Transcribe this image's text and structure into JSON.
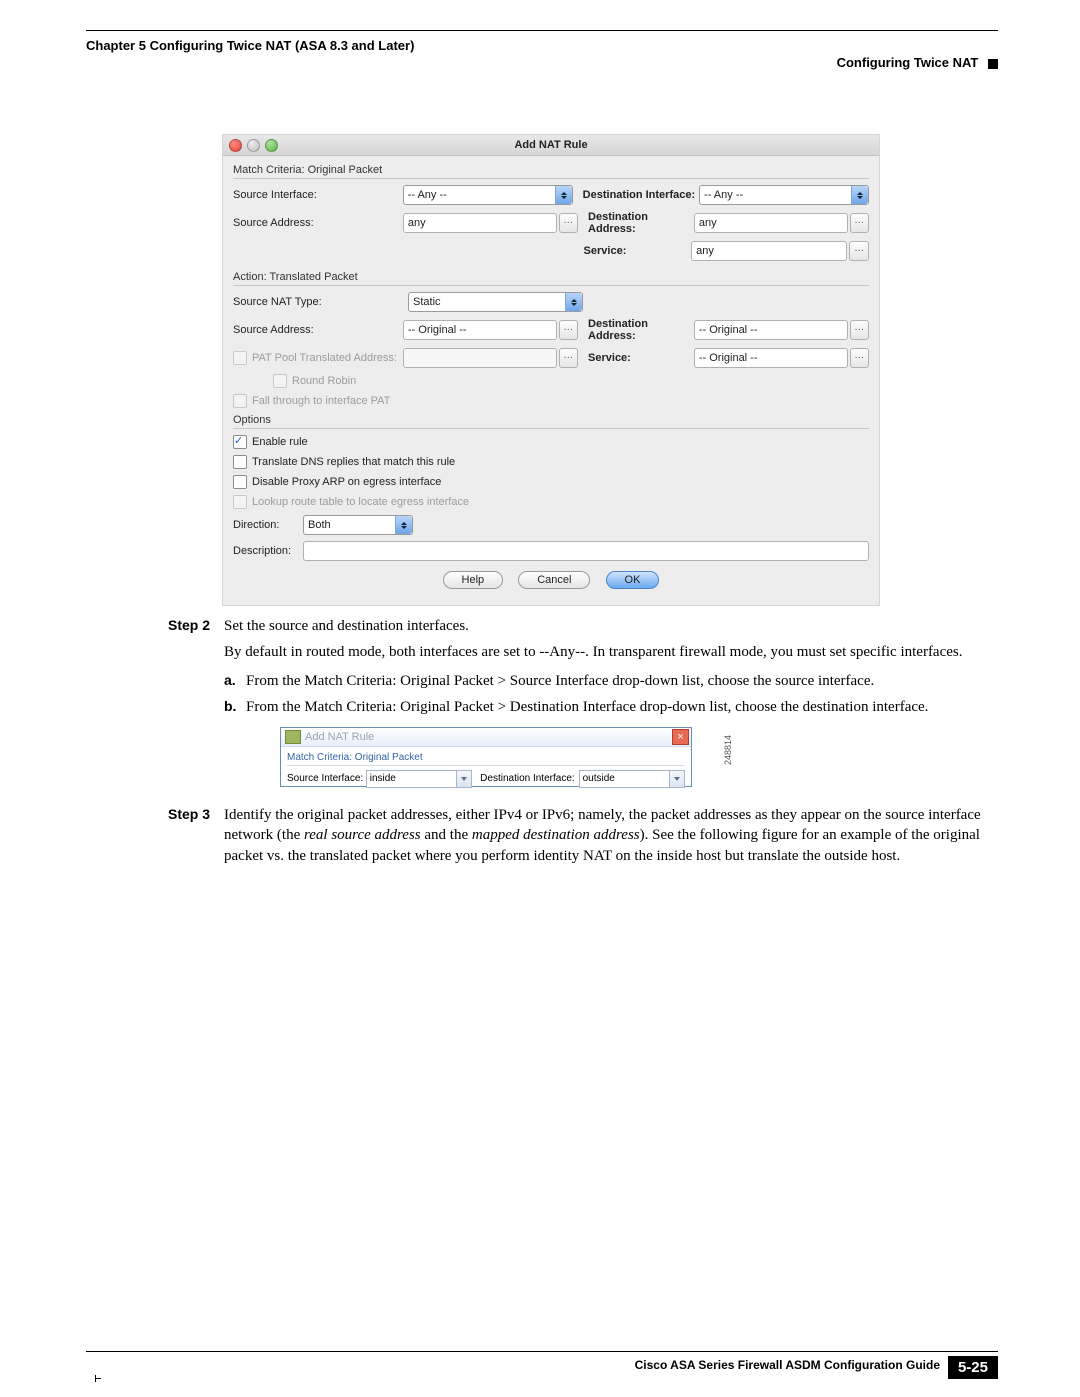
{
  "header": {
    "chapter": "Chapter 5      Configuring Twice NAT (ASA 8.3 and Later)",
    "section": "Configuring Twice NAT"
  },
  "shot1": {
    "title": "Add NAT Rule",
    "group1": "Match Criteria: Original Packet",
    "srcIfLabel": "Source Interface:",
    "srcIfVal": "-- Any --",
    "dstIfLabel": "Destination Interface:",
    "dstIfVal": "-- Any --",
    "srcAddrLabel": "Source Address:",
    "srcAddrVal": "any",
    "dstAddrLabel": "Destination Address:",
    "dstAddrVal": "any",
    "serviceLabel": "Service:",
    "serviceVal": "any",
    "group2": "Action: Translated Packet",
    "natTypeLabel": "Source NAT Type:",
    "natTypeVal": "Static",
    "srcAddr2Label": "Source Address:",
    "srcAddr2Val": "-- Original --",
    "dstAddr2Label": "Destination Address:",
    "dstAddr2Val": "-- Original --",
    "patLabel": "PAT Pool Translated Address:",
    "service2Label": "Service:",
    "service2Val": "-- Original --",
    "rrLabel": "Round Robin",
    "fallLabel": "Fall through to interface PAT",
    "group3": "Options",
    "enableLabel": "Enable rule",
    "dnsLabel": "Translate DNS replies that match this rule",
    "proxyLabel": "Disable Proxy ARP on egress interface",
    "lookupLabel": "Lookup route table to locate egress interface",
    "dirLabel": "Direction:",
    "dirVal": "Both",
    "descLabel": "Description:",
    "help": "Help",
    "cancel": "Cancel",
    "ok": "OK"
  },
  "step2": {
    "label": "Step 2",
    "line1": "Set the source and destination interfaces.",
    "line2a": "By default in routed mode, both interfaces are set to --Any--. In transparent firewall mode, you must set specific interfaces.",
    "a": "From the Match Criteria: Original Packet > Source Interface drop-down list, choose the source interface.",
    "b": "From the Match Criteria: Original Packet > Destination Interface drop-down list, choose the destination interface."
  },
  "shot2": {
    "title": "Add NAT Rule",
    "grp": "Match Criteria: Original Packet",
    "siLabel": "Source Interface:",
    "siVal": "inside",
    "diLabel": "Destination Interface:",
    "diVal": "outside",
    "fignum": "248814"
  },
  "step3": {
    "label": "Step 3",
    "t1": "Identify the original packet addresses, either IPv4 or IPv6; namely, the packet addresses as they appear on the source interface network (the ",
    "i1": "real source address",
    "t2": " and the ",
    "i2": "mapped destination address",
    "t3": "). See the following figure for an example of the original packet vs. the translated packet where you perform identity NAT on the inside host but translate the outside host."
  },
  "footer": {
    "guide": "Cisco ASA Series Firewall ASDM Configuration Guide",
    "page": "5-25"
  }
}
